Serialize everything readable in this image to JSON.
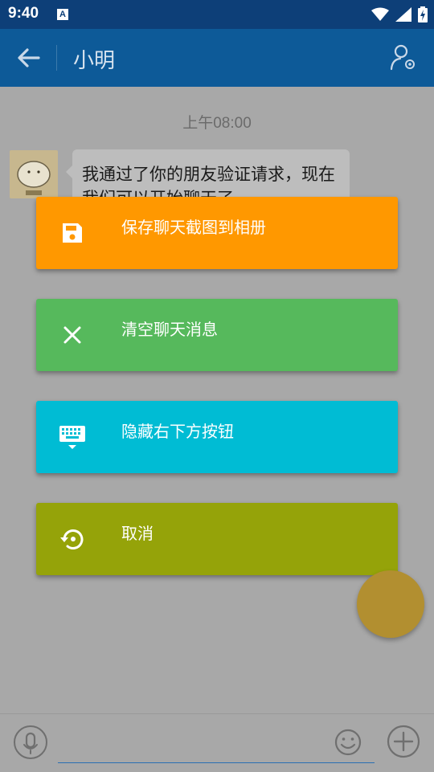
{
  "status_bar": {
    "time": "9:40",
    "notification_letter": "A",
    "icons": [
      "wifi-icon",
      "signal-icon",
      "battery-charging-icon"
    ]
  },
  "app_bar": {
    "title": "小明",
    "back_icon": "arrow-left-icon",
    "profile_icon": "person-settings-icon"
  },
  "chat": {
    "timestamp": "上午08:00",
    "message": "我通过了你的朋友验证请求，现在我们可以开始聊天了"
  },
  "menu": {
    "items": [
      {
        "label": "保存聊天截图到相册",
        "icon": "save-icon",
        "color": "#ff9800"
      },
      {
        "label": "清空聊天消息",
        "icon": "close-icon",
        "color": "#56b95c"
      },
      {
        "label": "隐藏右下方按钮",
        "icon": "keyboard-hide-icon",
        "color": "#00bcd4"
      },
      {
        "label": "取消",
        "icon": "restore-icon",
        "color": "#95a309"
      }
    ]
  },
  "input_bar": {
    "mic_icon": "microphone-icon",
    "text_value": "",
    "emoji_icon": "emoji-icon",
    "add_icon": "plus-circle-icon"
  },
  "colors": {
    "status_bar": "#0d3f78",
    "app_bar": "#0d5a98",
    "fab": "#b28f30"
  }
}
